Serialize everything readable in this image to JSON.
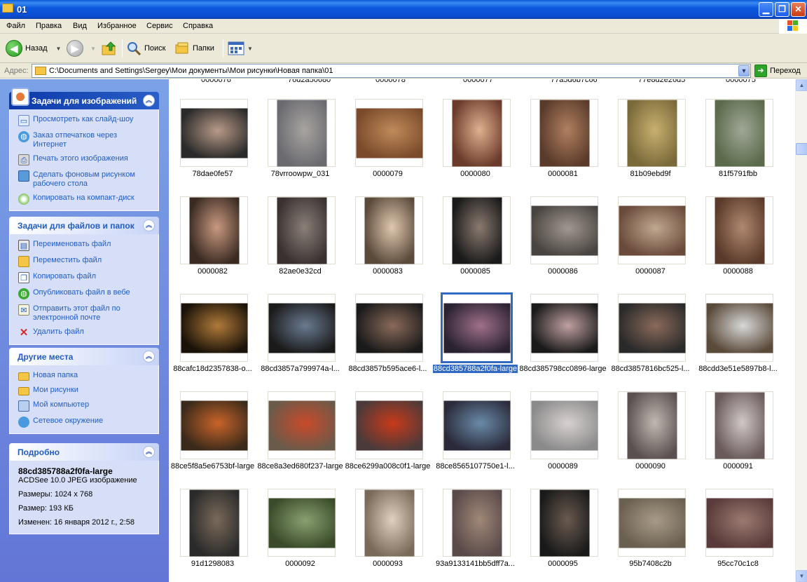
{
  "window": {
    "title": "01"
  },
  "menu": [
    "Файл",
    "Правка",
    "Вид",
    "Избранное",
    "Сервис",
    "Справка"
  ],
  "toolbar": {
    "back": "Назад",
    "search": "Поиск",
    "folders": "Папки"
  },
  "address": {
    "label": "Адрес:",
    "value": "C:\\Documents and Settings\\Sergey\\Мои документы\\Мои рисунки\\Новая папка\\01",
    "go": "Переход"
  },
  "image_tasks": {
    "title": "Задачи для изображений",
    "items": [
      "Просмотреть как слайд-шоу",
      "Заказ отпечатков через Интернет",
      "Печать этого изображения",
      "Сделать фоновым рисунком рабочего стола",
      "Копировать на компакт-диск"
    ]
  },
  "file_tasks": {
    "title": "Задачи для файлов и папок",
    "items": [
      "Переименовать файл",
      "Переместить файл",
      "Копировать файл",
      "Опубликовать файл в вебе",
      "Отправить этот файл по электронной почте",
      "Удалить файл"
    ]
  },
  "other_places": {
    "title": "Другие места",
    "items": [
      "Новая папка",
      "Мои рисунки",
      "Мой компьютер",
      "Сетевое окружение"
    ]
  },
  "details": {
    "title": "Подробно",
    "name": "88cd385788a2f0fa-large",
    "type": "ACDSee 10.0 JPEG изображение",
    "dimensions": "Размеры: 1024 x 768",
    "size": "Размер: 193 КБ",
    "modified": "Изменен: 16 января 2012 г., 2:58"
  },
  "thumbnails": [
    "78dae0fe57",
    "78vrroowpw_031",
    "0000079",
    "0000080",
    "0000081",
    "81b09ebd9f",
    "81f5791fbb",
    "0000082",
    "82ae0e32cd",
    "0000083",
    "0000085",
    "0000086",
    "0000087",
    "0000088",
    "88cafc18d2357838-o...",
    "88cd3857a799974a-l...",
    "88cd3857b595ace6-l...",
    "88cd385788a2f0fa-large",
    "88cd385798cc0896-large",
    "88cd3857816bc525-l...",
    "88cdd3e51e5897b8-l...",
    "88ce5f8a5e6753bf-large",
    "88ce8a3ed680f237-large",
    "88ce6299a008c0f1-large",
    "88ce8565107750e1-l...",
    "0000089",
    "0000090",
    "0000091",
    "91d1298083",
    "0000092",
    "0000093",
    "93a9133141bb5dff7a...",
    "0000095",
    "95b7408c2b",
    "95cc70c1c8"
  ],
  "selected_index": 17
}
